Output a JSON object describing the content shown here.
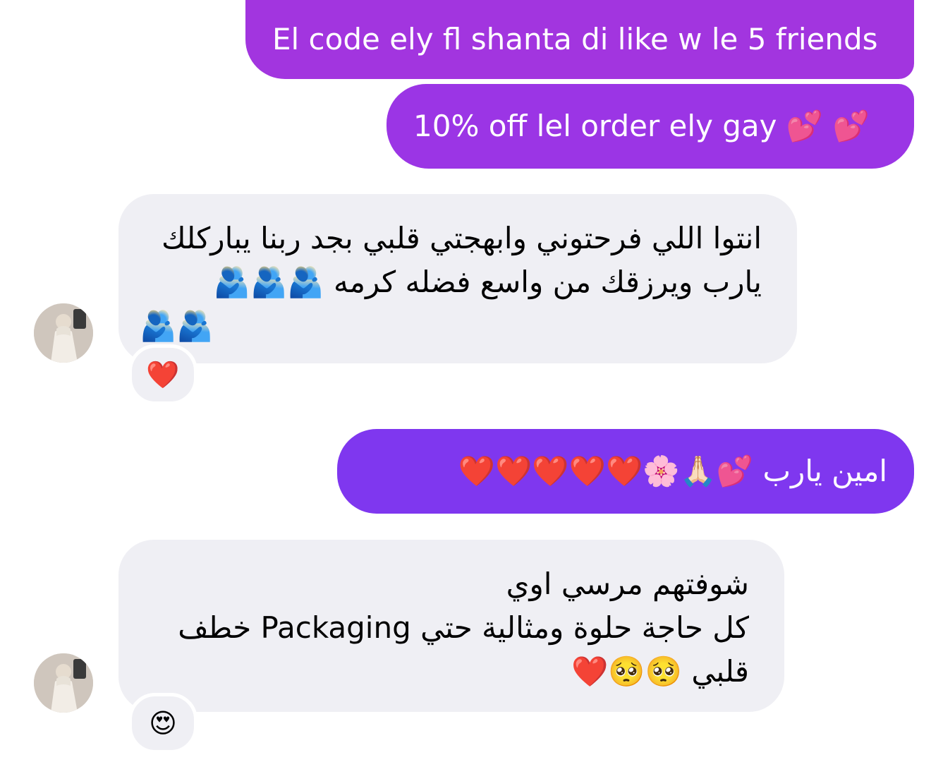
{
  "conversation": {
    "messages": [
      {
        "id": "m1",
        "direction": "outgoing",
        "text": "El code ely fl shanta di like w le 5 friends"
      },
      {
        "id": "m2",
        "direction": "outgoing",
        "text": "10% off lel order ely gay 💕 💕"
      },
      {
        "id": "m3",
        "direction": "incoming",
        "lines": [
          "انتوا اللي فرحتوني وابهجتي قلبي بجد ربنا يباركلك",
          "يارب ويرزقك من واسع فضله كرمه 🫂🫂🫂",
          "🫂🫂"
        ],
        "reaction": "❤️"
      },
      {
        "id": "m4",
        "direction": "outgoing",
        "text": "امين يارب 💕🙏🏻🌸❤️❤️❤️❤️❤️"
      },
      {
        "id": "m5",
        "direction": "incoming",
        "lines": [
          "شوفتهم مرسي اوي",
          "كل حاجة حلوة ومثالية حتي Packaging خطف",
          "قلبي 🥺🥺❤️"
        ],
        "reaction": "😍"
      }
    ]
  },
  "colors": {
    "outgoing_top": "#a034e0",
    "outgoing_mid": "#9a35e6",
    "outgoing_bottom": "#7e37f0",
    "incoming_bg": "#efeff4"
  },
  "avatar": {
    "icon": "contact-avatar-icon"
  }
}
